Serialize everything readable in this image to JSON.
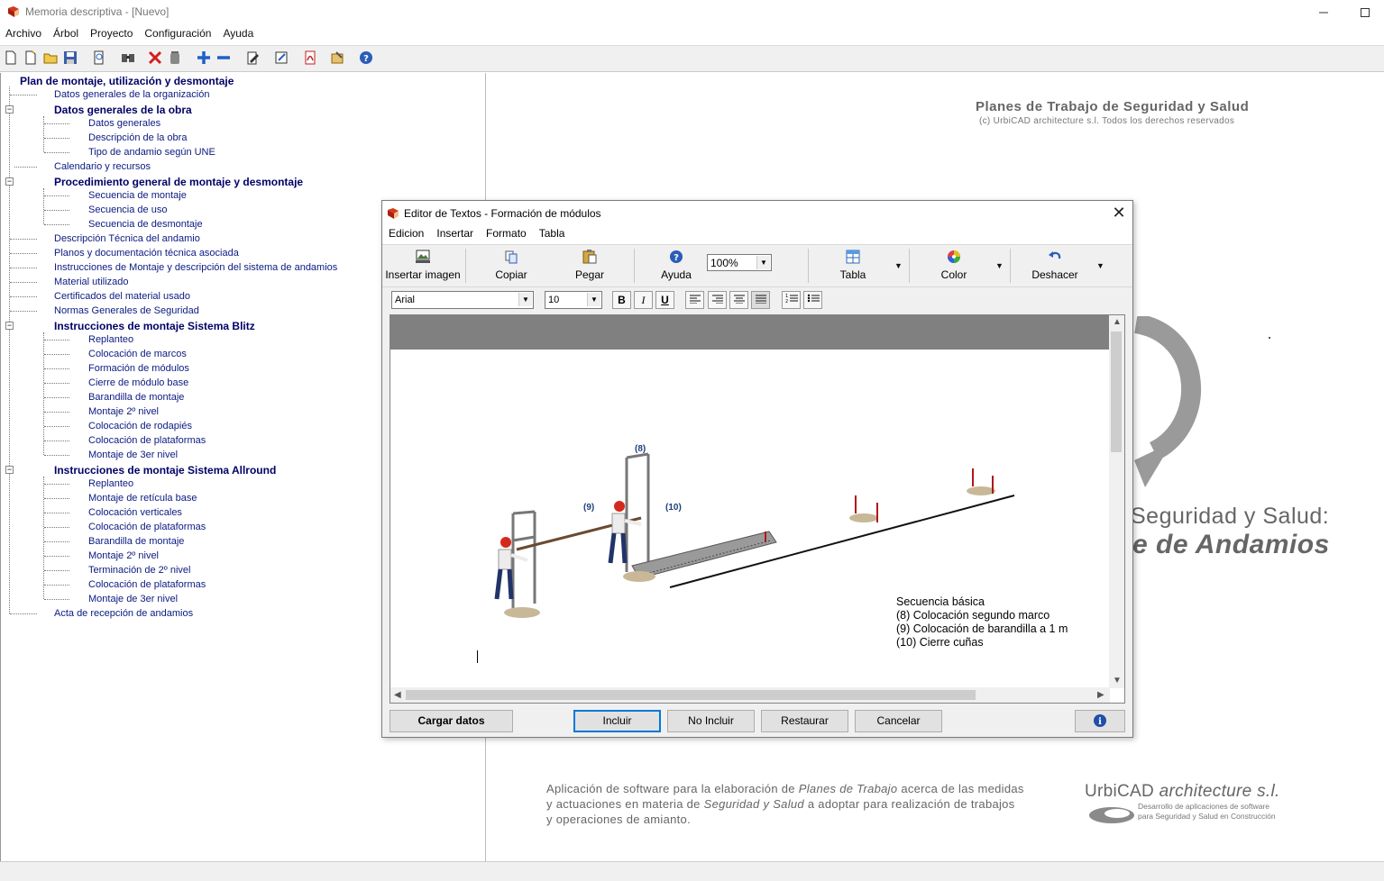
{
  "window": {
    "title": "Memoria descriptiva - [Nuevo]"
  },
  "menu": [
    "Archivo",
    "Árbol",
    "Proyecto",
    "Configuración",
    "Ayuda"
  ],
  "tree": {
    "root": "Plan de montaje, utilización y desmontaje",
    "items": [
      "Datos generales de la organización",
      "Datos generales de la obra",
      "Datos generales",
      "Descripción de la obra",
      "Tipo de andamio según UNE",
      "Calendario y recursos",
      "Procedimiento general de montaje y desmontaje",
      "Secuencia de montaje",
      "Secuencia de uso",
      "Secuencia de desmontaje",
      "Descripción Técnica del andamio",
      "Planos y documentación técnica asociada",
      "Instrucciones de Montaje y descripción del sistema de andamios",
      "Material utilizado",
      "Certificados del material usado",
      "Normas Generales de Seguridad",
      "Instrucciones de montaje Sistema Blitz",
      "Replanteo",
      "Colocación de marcos",
      "Formación de módulos",
      "Cierre de módulo base",
      "Barandilla de montaje",
      "Montaje 2º nivel",
      "Colocación de rodapiés",
      "Colocación de plataformas",
      "Montaje de 3er nivel",
      "Instrucciones de montaje Sistema Allround",
      "Replanteo",
      "Montaje de retícula base",
      "Colocación verticales",
      "Colocación de plataformas",
      "Barandilla de montaje",
      "Montaje 2º nivel",
      "Terminación de 2º nivel",
      "Colocación de plataformas",
      "Montaje de 3er nivel",
      "Acta de recepción de andamios"
    ]
  },
  "splash": {
    "heading": "Planes de Trabajo de Seguridad y Salud",
    "copyright": "(c) UrbiCAD architecture s.l.   Todos los derechos reservados",
    "big_line1": "Seguridad y Salud:",
    "big_line2": "e de Andamios",
    "footer_line1_a": "Aplicación de software para la elaboración de ",
    "footer_line1_b": "Planes de Trabajo",
    "footer_line1_c": " acerca de las medidas",
    "footer_line2_a": "y actuaciones en materia de ",
    "footer_line2_b": "Seguridad y Salud",
    "footer_line2_c": " a adoptar para realización de trabajos",
    "footer_line3": "y operaciones de amianto.",
    "company_a": "UrbiCAD ",
    "company_b": "architecture s.l.",
    "company_sub1": "Desarrollo de aplicaciones de software",
    "company_sub2": "para Seguridad y Salud en Construcción"
  },
  "dialog": {
    "title": "Editor de Textos - Formación de módulos",
    "menu": [
      "Edicion",
      "Insertar",
      "Formato",
      "Tabla"
    ],
    "toolbar": {
      "insert_image": "Insertar imagen",
      "copy": "Copiar",
      "paste": "Pegar",
      "help": "Ayuda",
      "zoom": "100%",
      "table": "Tabla",
      "color": "Color",
      "undo": "Deshacer"
    },
    "format": {
      "font": "Arial",
      "size": "10",
      "bold": "B",
      "italic": "I",
      "underline": "U"
    },
    "figure_labels": {
      "l8": "(8)",
      "l9": "(9)",
      "l10": "(10)"
    },
    "caption": [
      "Secuencia básica",
      "(8) Colocación segundo marco",
      "(9) Colocación de barandilla a 1 m",
      "(10) Cierre cuñas"
    ],
    "buttons": {
      "load": "Cargar datos",
      "include": "Incluir",
      "exclude": "No Incluir",
      "restore": "Restaurar",
      "cancel": "Cancelar"
    }
  },
  "colors": {
    "tree_text": "#0a1a80",
    "tree_bold": "#000066",
    "editor_header": "#808080",
    "splash_gray": "#666666",
    "hardhat": "#d42a1c"
  },
  "icons": [
    "app-book-icon",
    "new-icon",
    "wizard-icon",
    "open-icon",
    "save-icon",
    "preview-icon",
    "search-icon",
    "delete-icon",
    "trash-icon",
    "add-icon",
    "remove-icon",
    "edit-icon",
    "note-icon",
    "pdf-icon",
    "export-icon",
    "help-icon"
  ]
}
